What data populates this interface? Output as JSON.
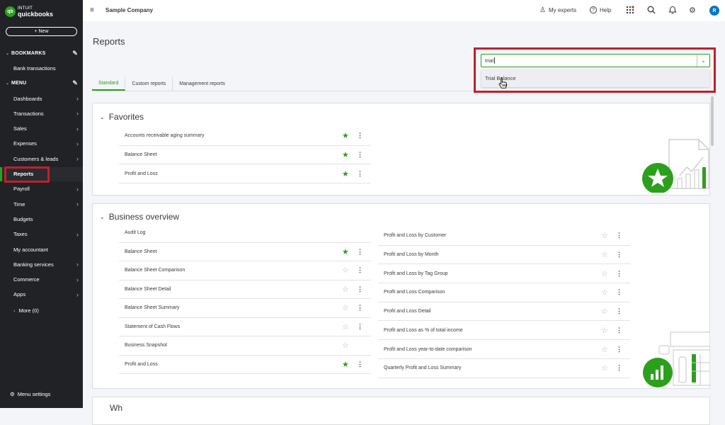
{
  "brand": {
    "logo_mark": "qb",
    "logo_small": "INTUIT",
    "logo_big": "quickbooks",
    "green": "#2ca01c",
    "highlight_red": "#c0202c"
  },
  "sidebar": {
    "new_label": "+ New",
    "bookmarks_label": "BOOKMARKS",
    "bookmark_items": [
      {
        "label": "Bank transactions"
      }
    ],
    "menu_label": "MENU",
    "items": [
      {
        "label": "Dashboards",
        "arrow": true
      },
      {
        "label": "Transactions",
        "arrow": true
      },
      {
        "label": "Sales",
        "arrow": true
      },
      {
        "label": "Expenses",
        "arrow": true
      },
      {
        "label": "Customers & leads",
        "arrow": true
      },
      {
        "label": "Reports",
        "arrow": false,
        "active": true
      },
      {
        "label": "Payroll",
        "arrow": true
      },
      {
        "label": "Time",
        "arrow": true
      },
      {
        "label": "Budgets",
        "arrow": false
      },
      {
        "label": "Taxes",
        "arrow": true
      },
      {
        "label": "My accountant",
        "arrow": false
      },
      {
        "label": "Banking services",
        "arrow": true
      },
      {
        "label": "Commerce",
        "arrow": true
      },
      {
        "label": "Apps",
        "arrow": true
      }
    ],
    "more_label": "More (0)",
    "menu_settings_label": "Menu settings"
  },
  "header": {
    "company": "Sample Company",
    "my_experts": "My experts",
    "help": "Help",
    "avatar_initial": "R"
  },
  "page": {
    "title": "Reports",
    "tabs": [
      {
        "label": "Standard",
        "active": true
      },
      {
        "label": "Custom reports"
      },
      {
        "label": "Management reports"
      }
    ],
    "search": {
      "value": "trial",
      "suggestion": "Trial Balance"
    }
  },
  "favorites": {
    "title": "Favorites",
    "items": [
      {
        "label": "Accounts receivable aging summary",
        "starred": true
      },
      {
        "label": "Balance Sheet",
        "starred": true
      },
      {
        "label": "Profit and Loss",
        "starred": true
      }
    ]
  },
  "business_overview": {
    "title": "Business overview",
    "left": [
      {
        "label": "Audit Log",
        "starred": null
      },
      {
        "label": "Balance Sheet",
        "starred": true
      },
      {
        "label": "Balance Sheet Comparison",
        "starred": false
      },
      {
        "label": "Balance Sheet Detail",
        "starred": false
      },
      {
        "label": "Balance Sheet Summary",
        "starred": false
      },
      {
        "label": "Statement of Cash Flows",
        "starred": false
      },
      {
        "label": "Business Snapshot",
        "starred": false,
        "no_menu": true
      },
      {
        "label": "Profit and Loss",
        "starred": true
      }
    ],
    "right": [
      {
        "label": "Profit and Loss by Customer",
        "starred": false
      },
      {
        "label": "Profit and Loss by Month",
        "starred": false
      },
      {
        "label": "Profit and Loss by Tag Group",
        "starred": false
      },
      {
        "label": "Profit and Loss Comparison",
        "starred": false
      },
      {
        "label": "Profit and Loss Detail",
        "starred": false
      },
      {
        "label": "Profit and Loss as % of total income",
        "starred": false
      },
      {
        "label": "Profit and Loss year-to-date comparison",
        "starred": false
      },
      {
        "label": "Quarterly Profit and Loss Summary",
        "starred": false
      }
    ]
  },
  "next_section": {
    "title": "Wh"
  }
}
